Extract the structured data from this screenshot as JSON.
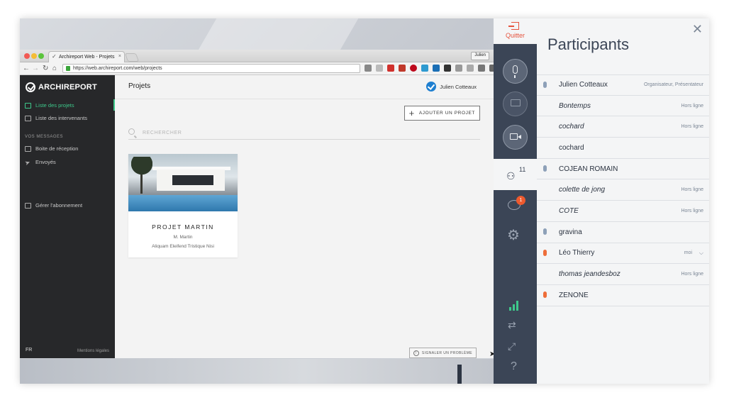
{
  "browser": {
    "tab_title": "Archireport Web - Projets",
    "tab_close": "×",
    "profile_name": "Julien",
    "url": "https://web.archireport.com/web/projects"
  },
  "sidebar": {
    "logo": "ARCHIREPORT",
    "items": [
      {
        "label": "Liste des projets"
      },
      {
        "label": "Liste des intervenants"
      }
    ],
    "section_label": "VOS MESSAGES",
    "messages": [
      {
        "label": "Boite de réception"
      },
      {
        "label": "Envoyés"
      }
    ],
    "subscription": "Gérer l'abonnement",
    "lang": "FR",
    "legal": "Mentions légales"
  },
  "content": {
    "title": "Projets",
    "user_name": "Julien Cotteaux",
    "add_project": "AJOUTER UN PROJET",
    "search_placeholder": "RECHERCHER",
    "project": {
      "name": "PROJET MARTIN",
      "owner": "M. Martin",
      "description": "Aliquam Eleifend Tristique Nisi"
    },
    "report_button": "SIGNALER UN PROBLÈME"
  },
  "call_bar": {
    "quit_label": "Quitter",
    "participants_count": "11",
    "chat_unread": "1",
    "signal_levels": [
      0.35,
      0.65,
      1.0
    ],
    "accent_color": "#3ec98b"
  },
  "participants": {
    "title": "Participants",
    "close": "✕",
    "list": [
      {
        "name": "Julien Cotteaux",
        "status": "Organisateur, Présentateur",
        "mic": "blue",
        "offline": false
      },
      {
        "name": "Bontemps",
        "status": "Hors ligne",
        "mic": "",
        "offline": true
      },
      {
        "name": "cochard",
        "status": "Hors ligne",
        "mic": "",
        "offline": true
      },
      {
        "name": "cochard",
        "status": "",
        "mic": "",
        "offline": false
      },
      {
        "name": "COJEAN ROMAIN",
        "status": "",
        "mic": "blue",
        "offline": false
      },
      {
        "name": "colette de jong",
        "status": "Hors ligne",
        "mic": "",
        "offline": true
      },
      {
        "name": "COTE",
        "status": "Hors ligne",
        "mic": "",
        "offline": true
      },
      {
        "name": "gravina",
        "status": "",
        "mic": "blue",
        "offline": false
      },
      {
        "name": "Léo Thierry",
        "status": "moi",
        "mic": "orange",
        "offline": false
      },
      {
        "name": "thomas jeandesboz",
        "status": "Hors ligne",
        "mic": "",
        "offline": true
      },
      {
        "name": "ZENONE",
        "status": "",
        "mic": "orange",
        "offline": false
      }
    ]
  }
}
